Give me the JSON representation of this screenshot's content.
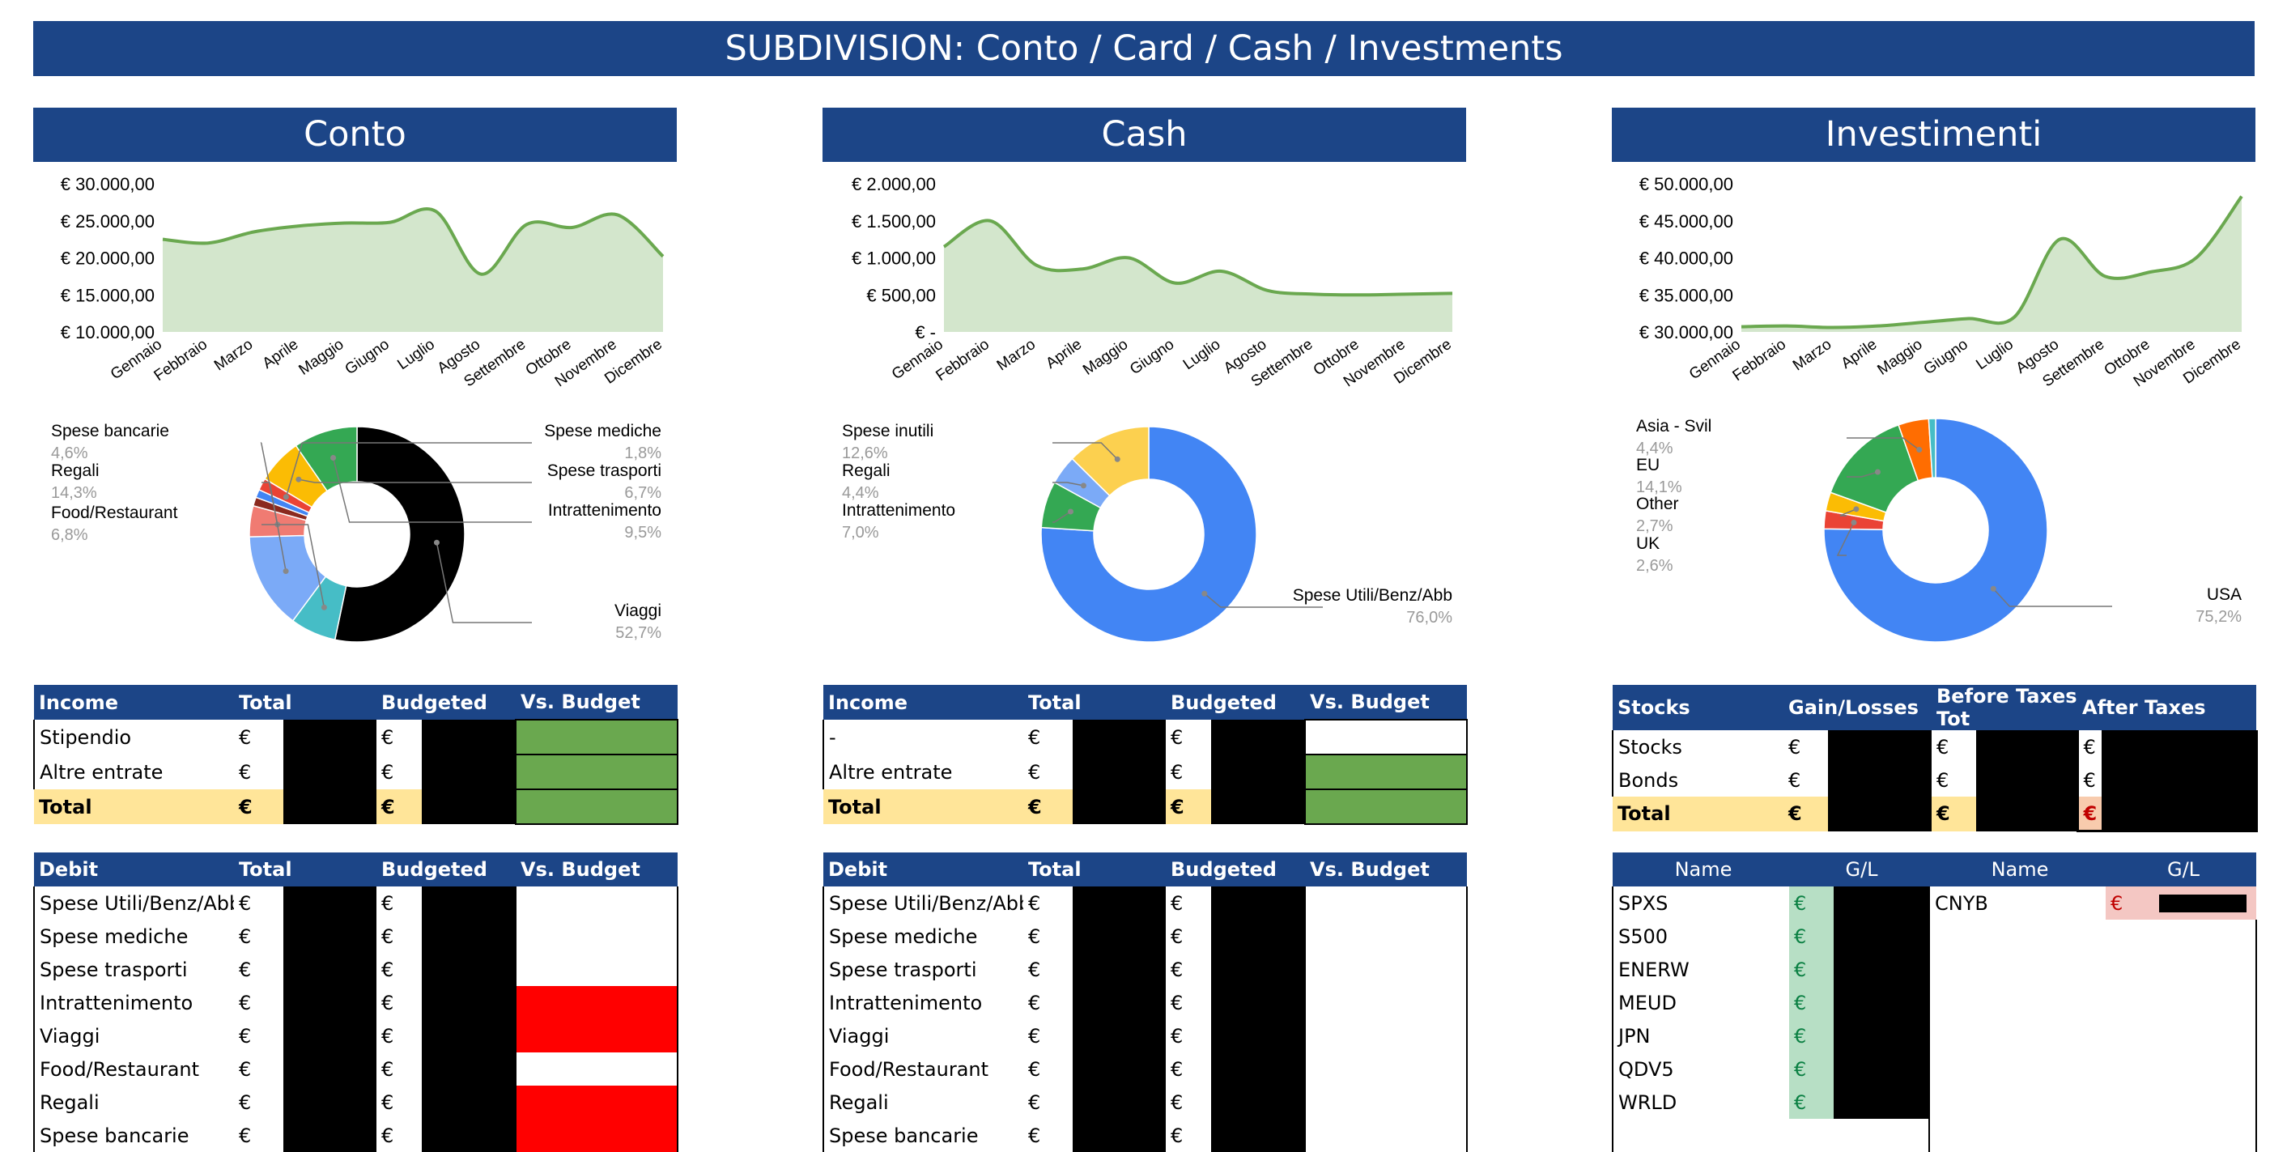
{
  "banner": {
    "title": "SUBDIVISION: Conto / Card / Cash / Investments"
  },
  "colors": {
    "header_blue": "#1c4587",
    "area_line": "#6aa84f",
    "area_fill": "#d3e6cc",
    "total_row": "#ffe599",
    "budget_ok": "#6aa84f",
    "budget_over": "#ff0000",
    "gain_cell": "#b7dfc5",
    "loss_cell": "#f4c7c3"
  },
  "sections": {
    "conto": {
      "title": "Conto"
    },
    "cash": {
      "title": "Cash"
    },
    "investimenti": {
      "title": "Investimenti"
    }
  },
  "chart_data": [
    {
      "id": "conto-area",
      "type": "area",
      "categories": [
        "Gennaio",
        "Febbraio",
        "Marzo",
        "Aprile",
        "Maggio",
        "Giugno",
        "Luglio",
        "Agosto",
        "Settembre",
        "Ottobre",
        "Novembre",
        "Dicembre"
      ],
      "values": [
        22500,
        22000,
        23500,
        24300,
        24700,
        24800,
        26300,
        17800,
        24500,
        24100,
        25800,
        20200
      ],
      "ylim": [
        10000,
        30000
      ],
      "yticks": [
        "€ 30.000,00",
        "€ 25.000,00",
        "€ 20.000,00",
        "€ 15.000,00",
        "€ 10.000,00"
      ],
      "ytick_values": [
        30000,
        25000,
        20000,
        15000,
        10000
      ]
    },
    {
      "id": "cash-area",
      "type": "area",
      "categories": [
        "Gennaio",
        "Febbraio",
        "Marzo",
        "Aprile",
        "Maggio",
        "Giugno",
        "Luglio",
        "Agosto",
        "Settembre",
        "Ottobre",
        "Novembre",
        "Dicembre"
      ],
      "values": [
        1150,
        1500,
        900,
        850,
        1000,
        660,
        820,
        560,
        510,
        500,
        510,
        520
      ],
      "ylim": [
        0,
        2000
      ],
      "yticks": [
        "€ 2.000,00",
        "€ 1.500,00",
        "€ 1.000,00",
        "€ 500,00",
        "€ -"
      ],
      "ytick_values": [
        2000,
        1500,
        1000,
        500,
        0
      ]
    },
    {
      "id": "inv-area",
      "type": "area",
      "categories": [
        "Gennaio",
        "Febbraio",
        "Marzo",
        "Aprile",
        "Maggio",
        "Giugno",
        "Luglio",
        "Agosto",
        "Settembre",
        "Ottobre",
        "Novembre",
        "Dicembre"
      ],
      "values": [
        30700,
        30800,
        30600,
        30800,
        31300,
        31800,
        32000,
        42500,
        37500,
        38100,
        40000,
        48300
      ],
      "ylim": [
        30000,
        50000
      ],
      "yticks": [
        "€ 50.000,00",
        "€ 45.000,00",
        "€ 40.000,00",
        "€ 35.000,00",
        "€ 30.000,00"
      ],
      "ytick_values": [
        50000,
        45000,
        40000,
        35000,
        30000
      ]
    },
    {
      "id": "conto-pie",
      "type": "pie",
      "slices": [
        {
          "label": "Viaggi",
          "value": 52.7,
          "text": "52,7%",
          "color": "#000000"
        },
        {
          "label": "Food/Restaurant",
          "value": 6.8,
          "text": "6,8%",
          "color": "#46bdc6"
        },
        {
          "label": "Regali",
          "value": 14.3,
          "text": "14,3%",
          "color": "#7baaf7"
        },
        {
          "label": "Spese bancarie",
          "value": 4.6,
          "text": "4,6%",
          "color": "#f07b72"
        },
        {
          "label": "",
          "value": 1.3,
          "text": "",
          "color": "#8b2a1f"
        },
        {
          "label": "",
          "value": 1.2,
          "text": "",
          "color": "#4285f4"
        },
        {
          "label": "Spese mediche",
          "value": 1.8,
          "text": "1,8%",
          "color": "#ea4335"
        },
        {
          "label": "Spese trasporti",
          "value": 6.7,
          "text": "6,7%",
          "color": "#fbbc04"
        },
        {
          "label": "Intrattenimento",
          "value": 9.5,
          "text": "9,5%",
          "color": "#34a853"
        }
      ]
    },
    {
      "id": "cash-pie",
      "type": "pie",
      "slices": [
        {
          "label": "Spese Utili/Benz/Abb",
          "value": 76.0,
          "text": "76,0%",
          "color": "#4285f4"
        },
        {
          "label": "Intrattenimento",
          "value": 7.0,
          "text": "7,0%",
          "color": "#34a853"
        },
        {
          "label": "Regali",
          "value": 4.4,
          "text": "4,4%",
          "color": "#7baaf7"
        },
        {
          "label": "Spese inutili",
          "value": 12.6,
          "text": "12,6%",
          "color": "#fcd04f"
        }
      ]
    },
    {
      "id": "inv-pie",
      "type": "pie",
      "slices": [
        {
          "label": "USA",
          "value": 75.2,
          "text": "75,2%",
          "color": "#4285f4"
        },
        {
          "label": "UK",
          "value": 2.6,
          "text": "2,6%",
          "color": "#ea4335"
        },
        {
          "label": "Other",
          "value": 2.7,
          "text": "2,7%",
          "color": "#fbbc04"
        },
        {
          "label": "EU",
          "value": 14.1,
          "text": "14,1%",
          "color": "#34a853"
        },
        {
          "label": "Asia - Svil",
          "value": 4.4,
          "text": "4,4%",
          "color": "#ff6d01"
        },
        {
          "label": "",
          "value": 1.0,
          "text": "",
          "color": "#46bdc6"
        }
      ]
    }
  ],
  "conto_income": {
    "headers": [
      "Income",
      "Total",
      "Budgeted",
      "Vs. Budget"
    ],
    "rows": [
      {
        "label": "Stipendio",
        "euro": "€"
      },
      {
        "label": "Altre entrate",
        "euro": "€"
      }
    ],
    "total": {
      "label": "Total",
      "euro": "€"
    }
  },
  "conto_debit": {
    "headers": [
      "Debit",
      "Total",
      "Budgeted",
      "Vs. Budget"
    ],
    "rows": [
      {
        "label": "Spese Utili/Benz/Abb",
        "euro": "€",
        "status": "none"
      },
      {
        "label": "Spese mediche",
        "euro": "€",
        "status": "none"
      },
      {
        "label": "Spese trasporti",
        "euro": "€",
        "status": "none"
      },
      {
        "label": "Intrattenimento",
        "euro": "€",
        "status": "over"
      },
      {
        "label": "Viaggi",
        "euro": "€",
        "status": "over"
      },
      {
        "label": "Food/Restaurant",
        "euro": "€",
        "status": "none"
      },
      {
        "label": "Regali",
        "euro": "€",
        "status": "over"
      },
      {
        "label": "Spese bancarie",
        "euro": "€",
        "status": "over"
      }
    ]
  },
  "cash_income": {
    "headers": [
      "Income",
      "Total",
      "Budgeted",
      "Vs. Budget"
    ],
    "rows": [
      {
        "label": "-",
        "euro": "€"
      },
      {
        "label": "Altre entrate",
        "euro": "€"
      }
    ],
    "total": {
      "label": "Total",
      "euro": "€"
    }
  },
  "cash_debit": {
    "headers": [
      "Debit",
      "Total",
      "Budgeted",
      "Vs. Budget"
    ],
    "rows": [
      {
        "label": "Spese Utili/Benz/Abb",
        "euro": "€"
      },
      {
        "label": "Spese mediche",
        "euro": "€"
      },
      {
        "label": "Spese trasporti",
        "euro": "€"
      },
      {
        "label": "Intrattenimento",
        "euro": "€"
      },
      {
        "label": "Viaggi",
        "euro": "€"
      },
      {
        "label": "Food/Restaurant",
        "euro": "€"
      },
      {
        "label": "Regali",
        "euro": "€"
      },
      {
        "label": "Spese bancarie",
        "euro": "€"
      }
    ]
  },
  "inv_stocks": {
    "headers": [
      "Stocks",
      "Gain/Losses",
      "Before Taxes Tot",
      "After Taxes"
    ],
    "rows": [
      {
        "label": "Stocks",
        "euro": "€"
      },
      {
        "label": "Bonds",
        "euro": "€"
      }
    ],
    "total": {
      "label": "Total",
      "euro": "€"
    }
  },
  "inv_positions": {
    "headers": [
      "Name",
      "G/L",
      "Name",
      "G/L"
    ],
    "gains": [
      {
        "name": "SPXS",
        "euro": "€"
      },
      {
        "name": "S500",
        "euro": "€"
      },
      {
        "name": "ENERW",
        "euro": "€"
      },
      {
        "name": "MEUD",
        "euro": "€"
      },
      {
        "name": "JPN",
        "euro": "€"
      },
      {
        "name": "QDV5",
        "euro": "€"
      },
      {
        "name": "WRLD",
        "euro": "€"
      }
    ],
    "losses": [
      {
        "name": "CNYB",
        "euro": "€"
      }
    ]
  }
}
